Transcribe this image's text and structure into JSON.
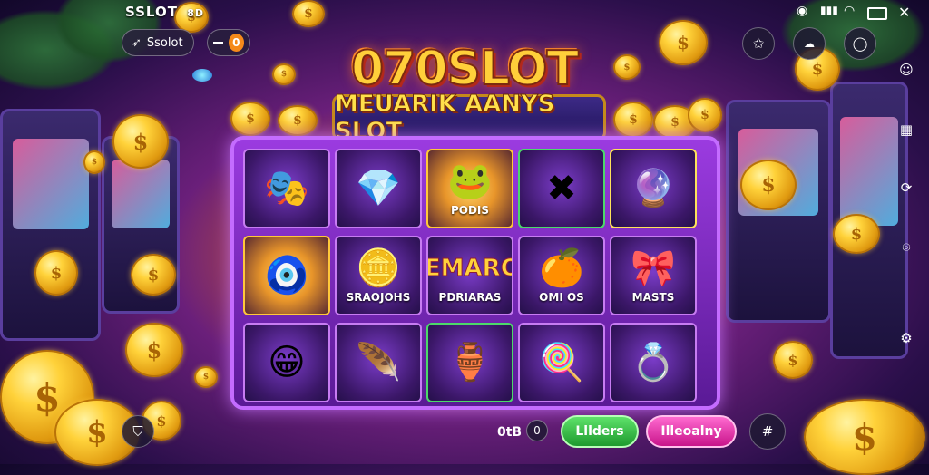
{
  "brand": "SSLOT",
  "brand_badge": "8D",
  "top_left": {
    "username": "Ssolot",
    "badge_value": "0"
  },
  "status_bar": {
    "close": "✕"
  },
  "title": "070SLOT",
  "subtitle": "MEUARIK AANYS SLOT",
  "reels": [
    [
      {
        "symbol": "mask-blue-icon",
        "glyph": "🎭",
        "caption": ""
      },
      {
        "symbol": "gem-purple-icon",
        "glyph": "💎",
        "caption": ""
      },
      {
        "symbol": "green-frog-icon",
        "glyph": "🐸",
        "caption": "PODIS",
        "highlight": "gold"
      },
      {
        "symbol": "gold-cross-icon",
        "glyph": "✖",
        "caption": "",
        "highlight": "green"
      },
      {
        "symbol": "crystal-icon",
        "glyph": "🔮",
        "caption": "",
        "highlight": "yellow"
      }
    ],
    [
      {
        "symbol": "gold-amulet-icon",
        "glyph": "🧿",
        "caption": "",
        "highlight": "gold"
      },
      {
        "symbol": "gold-bars-icon",
        "glyph": "🪙",
        "caption": "SRAOJOHS"
      },
      {
        "symbol": "mask-text",
        "glyph": "MEMAROK",
        "caption": "PDRIARAS"
      },
      {
        "symbol": "orange-orb-icon",
        "glyph": "🍊",
        "caption": "OMI OS"
      },
      {
        "symbol": "green-bow-icon",
        "glyph": "🎀",
        "caption": "MASTS"
      }
    ],
    [
      {
        "symbol": "gold-face-icon",
        "glyph": "😁",
        "caption": ""
      },
      {
        "symbol": "blue-feather-icon",
        "glyph": "🪶",
        "caption": ""
      },
      {
        "symbol": "gold-lamp-icon",
        "glyph": "🏺",
        "caption": "",
        "highlight": "green"
      },
      {
        "symbol": "candy-swirl-icon",
        "glyph": "🍭",
        "caption": ""
      },
      {
        "symbol": "purple-ring-icon",
        "glyph": "💍",
        "caption": ""
      }
    ]
  ],
  "bottom": {
    "credit": "0tB",
    "credit_badge": "0",
    "green_button": "Lllders",
    "pink_button": "Illeoalny"
  }
}
